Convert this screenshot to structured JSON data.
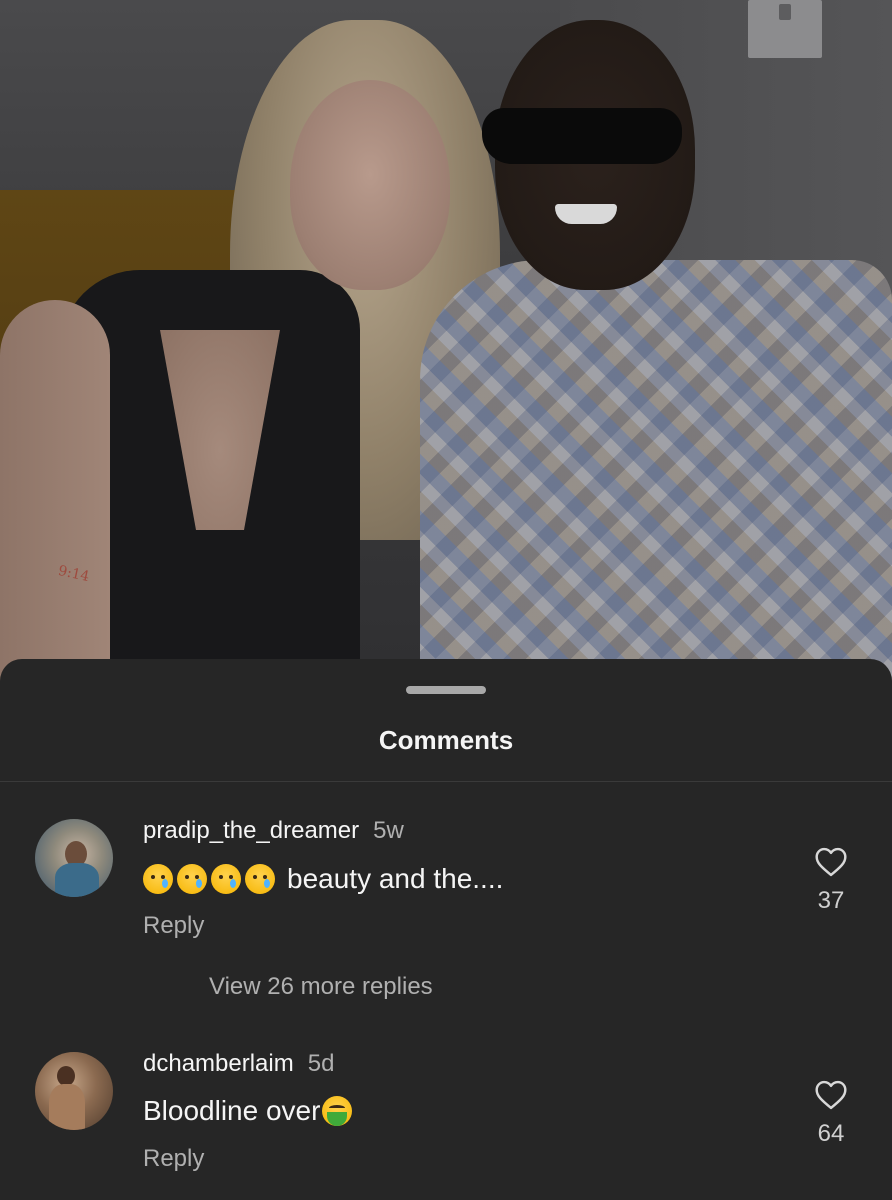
{
  "photo": {
    "tattoo_text": "9:14"
  },
  "sheet": {
    "title": "Comments"
  },
  "comments": [
    {
      "username": "pradip_the_dreamer",
      "time": "5w",
      "emojis": [
        "crying-face",
        "crying-face",
        "crying-face",
        "crying-face"
      ],
      "text": "beauty and the....",
      "reply_label": "Reply",
      "likes": "37",
      "view_more": "View 26 more replies"
    },
    {
      "username": "dchamberlaim",
      "time": "5d",
      "text": "Bloodline over",
      "emojis": [
        "vomiting-face"
      ],
      "reply_label": "Reply",
      "likes": "64"
    }
  ],
  "icons": {
    "like": "heart-outline-icon"
  },
  "colors": {
    "sheet_bg": "#262626",
    "text_primary": "#f5f5f5",
    "text_secondary": "#b0b0b0"
  }
}
